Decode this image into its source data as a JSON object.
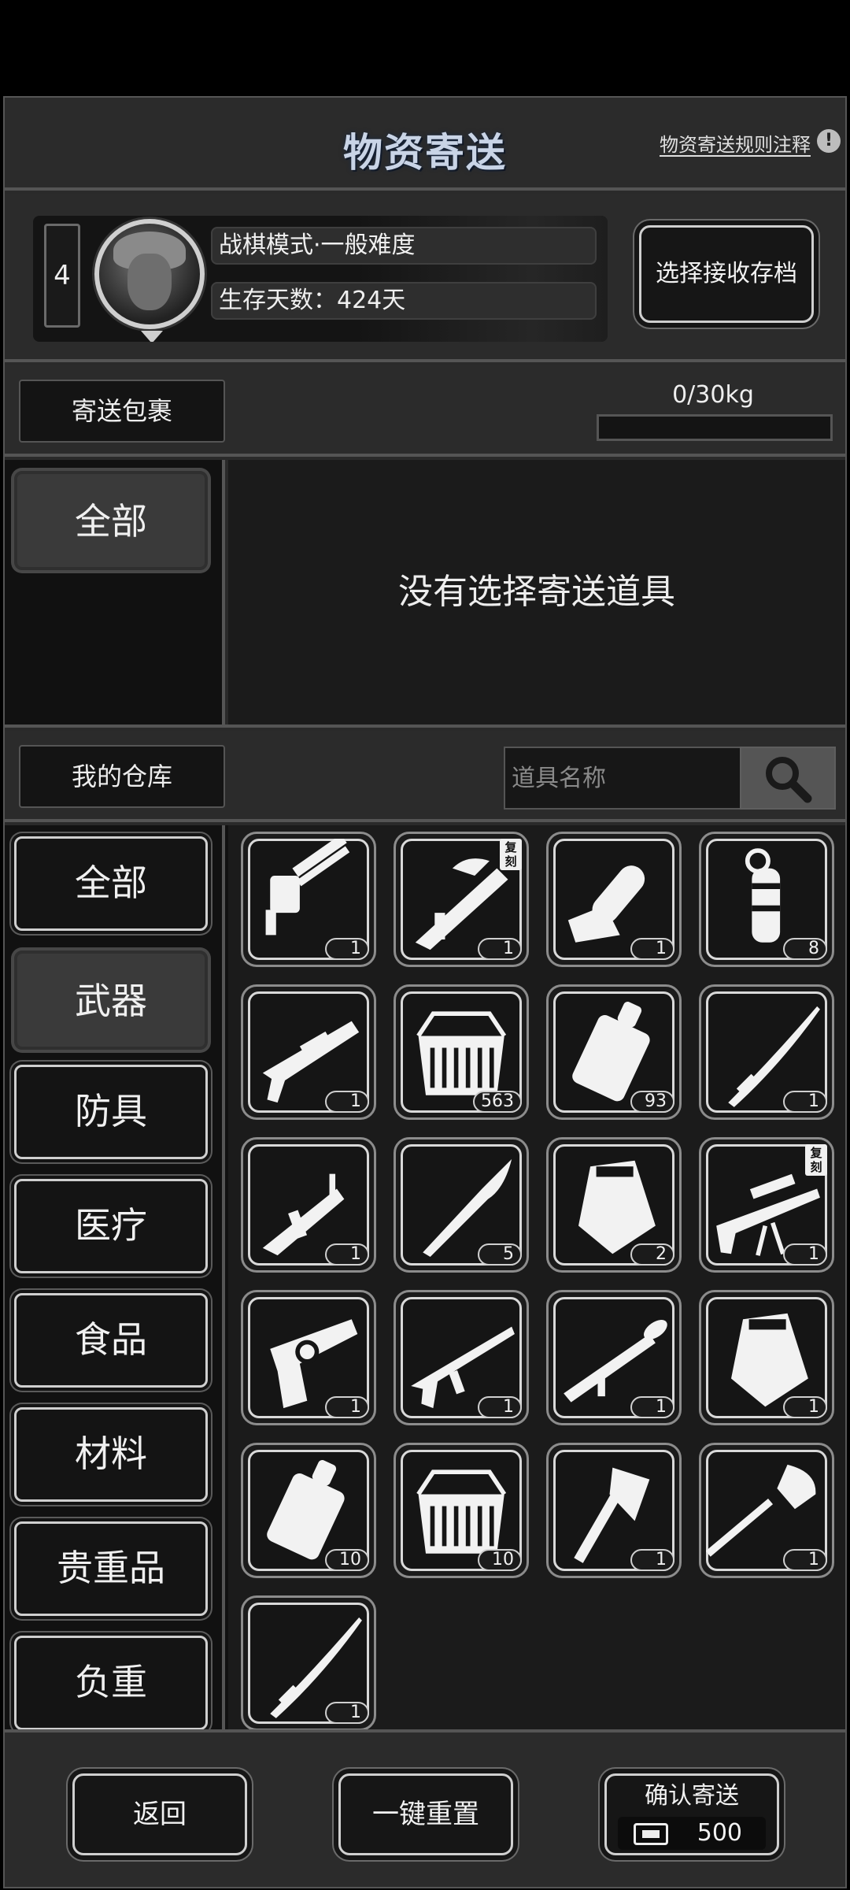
{
  "header": {
    "title": "物资寄送",
    "rules_link": "物资寄送规则注释",
    "info_glyph": "!"
  },
  "save_slot": {
    "slot_number": "4",
    "mode_text": "战棋模式·一般难度",
    "survival_text": "生存天数：424天",
    "select_button": "选择接收存档"
  },
  "parcel": {
    "label": "寄送包裹",
    "weight_text": "0/30kg",
    "weight_fraction": 0,
    "tab_all": "全部",
    "empty_text": "没有选择寄送道具"
  },
  "warehouse": {
    "label": "我的仓库",
    "search_placeholder": "道具名称",
    "categories": [
      "全部",
      "武器",
      "防具",
      "医疗",
      "食品",
      "材料",
      "贵重品",
      "负重"
    ],
    "active_category": "武器",
    "items": [
      {
        "icon": "minigun-icon",
        "qty": "1"
      },
      {
        "icon": "dragon-rifle-icon",
        "qty": "1",
        "tag": "复刻"
      },
      {
        "icon": "chainsaw-icon",
        "qty": "1"
      },
      {
        "icon": "grenade-icon",
        "qty": "8"
      },
      {
        "icon": "shotgun-icon",
        "qty": "1"
      },
      {
        "icon": "ammo-box-icon",
        "qty": "563"
      },
      {
        "icon": "fuel-canister-icon",
        "qty": "93"
      },
      {
        "icon": "katana-icon",
        "qty": "1"
      },
      {
        "icon": "smg-icon",
        "qty": "1"
      },
      {
        "icon": "knife-icon",
        "qty": "5"
      },
      {
        "icon": "armor-plate-icon",
        "qty": "2"
      },
      {
        "icon": "sniper-rifle-icon",
        "qty": "1",
        "tag": "复刻"
      },
      {
        "icon": "revolver-icon",
        "qty": "1"
      },
      {
        "icon": "assault-rifle-icon",
        "qty": "1"
      },
      {
        "icon": "rocket-launcher-icon",
        "qty": "1"
      },
      {
        "icon": "armor-plate-icon",
        "qty": "1"
      },
      {
        "icon": "fuel-canister-icon",
        "qty": "10"
      },
      {
        "icon": "ammo-box-icon",
        "qty": "10"
      },
      {
        "icon": "axe-icon",
        "qty": "1"
      },
      {
        "icon": "shovel-icon",
        "qty": "1"
      },
      {
        "icon": "katana-icon",
        "qty": "1"
      }
    ]
  },
  "footer": {
    "back": "返回",
    "reset": "一键重置",
    "confirm": "确认寄送",
    "cost": "500",
    "cost_icon": "ticket-icon"
  }
}
